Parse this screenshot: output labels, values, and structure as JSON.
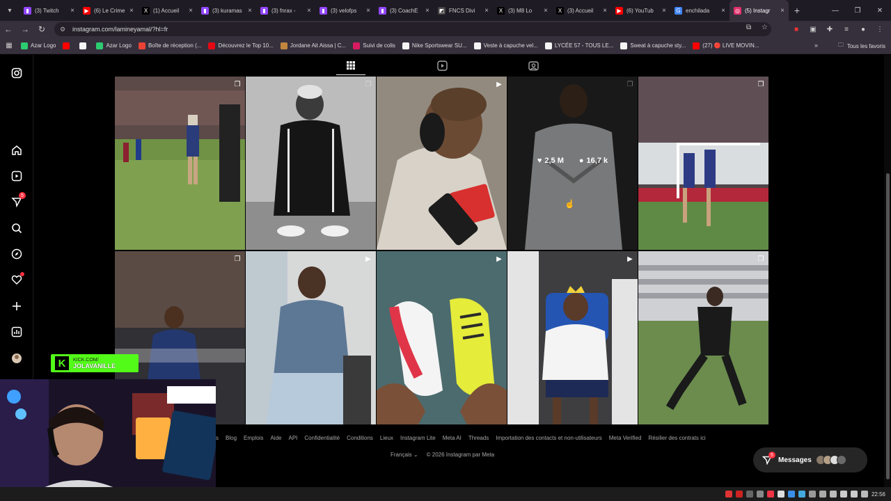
{
  "browser": {
    "tabs": [
      {
        "title": "(3) Twitch",
        "color": "#9146ff",
        "glyph": "▮"
      },
      {
        "title": "(6) Le Crime",
        "color": "#ff0000",
        "glyph": "▶"
      },
      {
        "title": "(1) Accueil",
        "color": "#000000",
        "glyph": "X"
      },
      {
        "title": "(3) kuramas",
        "color": "#9146ff",
        "glyph": "▮"
      },
      {
        "title": "(3) fnrax -",
        "color": "#9146ff",
        "glyph": "▮"
      },
      {
        "title": "(3) velofps",
        "color": "#9146ff",
        "glyph": "▮"
      },
      {
        "title": "(3) CoachE",
        "color": "#9146ff",
        "glyph": "▮"
      },
      {
        "title": "FNCS Divi",
        "color": "#444444",
        "glyph": "◩"
      },
      {
        "title": "(3) M8 Lo",
        "color": "#000000",
        "glyph": "X"
      },
      {
        "title": "(3) Accueil",
        "color": "#000000",
        "glyph": "X"
      },
      {
        "title": "(6) YouTub",
        "color": "#ff0000",
        "glyph": "▶"
      },
      {
        "title": "enchilada",
        "color": "#4285f4",
        "glyph": "G"
      },
      {
        "title": "(5) Instagr",
        "color": "#e1306c",
        "glyph": "◎",
        "active": true
      }
    ],
    "url": "instagram.com/lamineyamal/?hl=fr",
    "bookmarks": [
      {
        "label": "Azar Logo",
        "color": "#2ecc71"
      },
      {
        "label": "",
        "color": "#ff0000"
      },
      {
        "label": "",
        "color": "#f5f5f5"
      },
      {
        "label": "Azar Logo",
        "color": "#2ecc71"
      },
      {
        "label": "Boîte de réception (...",
        "color": "#ea4335"
      },
      {
        "label": "Découvrez le Top 10...",
        "color": "#e50914"
      },
      {
        "label": "Jordane Ait Aissa | C...",
        "color": "#c0863e"
      },
      {
        "label": "Suivi de colis",
        "color": "#d81b60"
      },
      {
        "label": "Nike Sportswear SU...",
        "color": "#f5f5f5"
      },
      {
        "label": "Veste à capuche vel...",
        "color": "#f5f5f5"
      },
      {
        "label": "LYCÉE 57 - TOUS LE...",
        "color": "#f5f5f5"
      },
      {
        "label": "Sweat à capuche sty...",
        "color": "#f5f5f5"
      },
      {
        "label": "(27) 🔴 LIVE MOVIN...",
        "color": "#ff0000"
      }
    ],
    "all_favorites": "Tous les favoris"
  },
  "sidebar": {
    "notif_badge": "5"
  },
  "grid": {
    "hover_likes": "2,5 M",
    "hover_comments": "16,7 k"
  },
  "footer": {
    "links": [
      "s",
      "Blog",
      "Emplois",
      "Aide",
      "API",
      "Confidentialité",
      "Conditions",
      "Lieux",
      "Instagram Lite",
      "Meta AI",
      "Threads",
      "Importation des contacts et non-utilisateurs",
      "Meta Verified",
      "Résilier des contrats ici"
    ],
    "language": "Français",
    "copyright": "© 2026 Instagram par Meta"
  },
  "messages": {
    "label": "Messages",
    "badge": "5"
  },
  "stream": {
    "kick_line1": "KICK.COM/",
    "kick_line2": "JOLAVANILLE"
  },
  "taskbar": {
    "time": "22:56"
  }
}
